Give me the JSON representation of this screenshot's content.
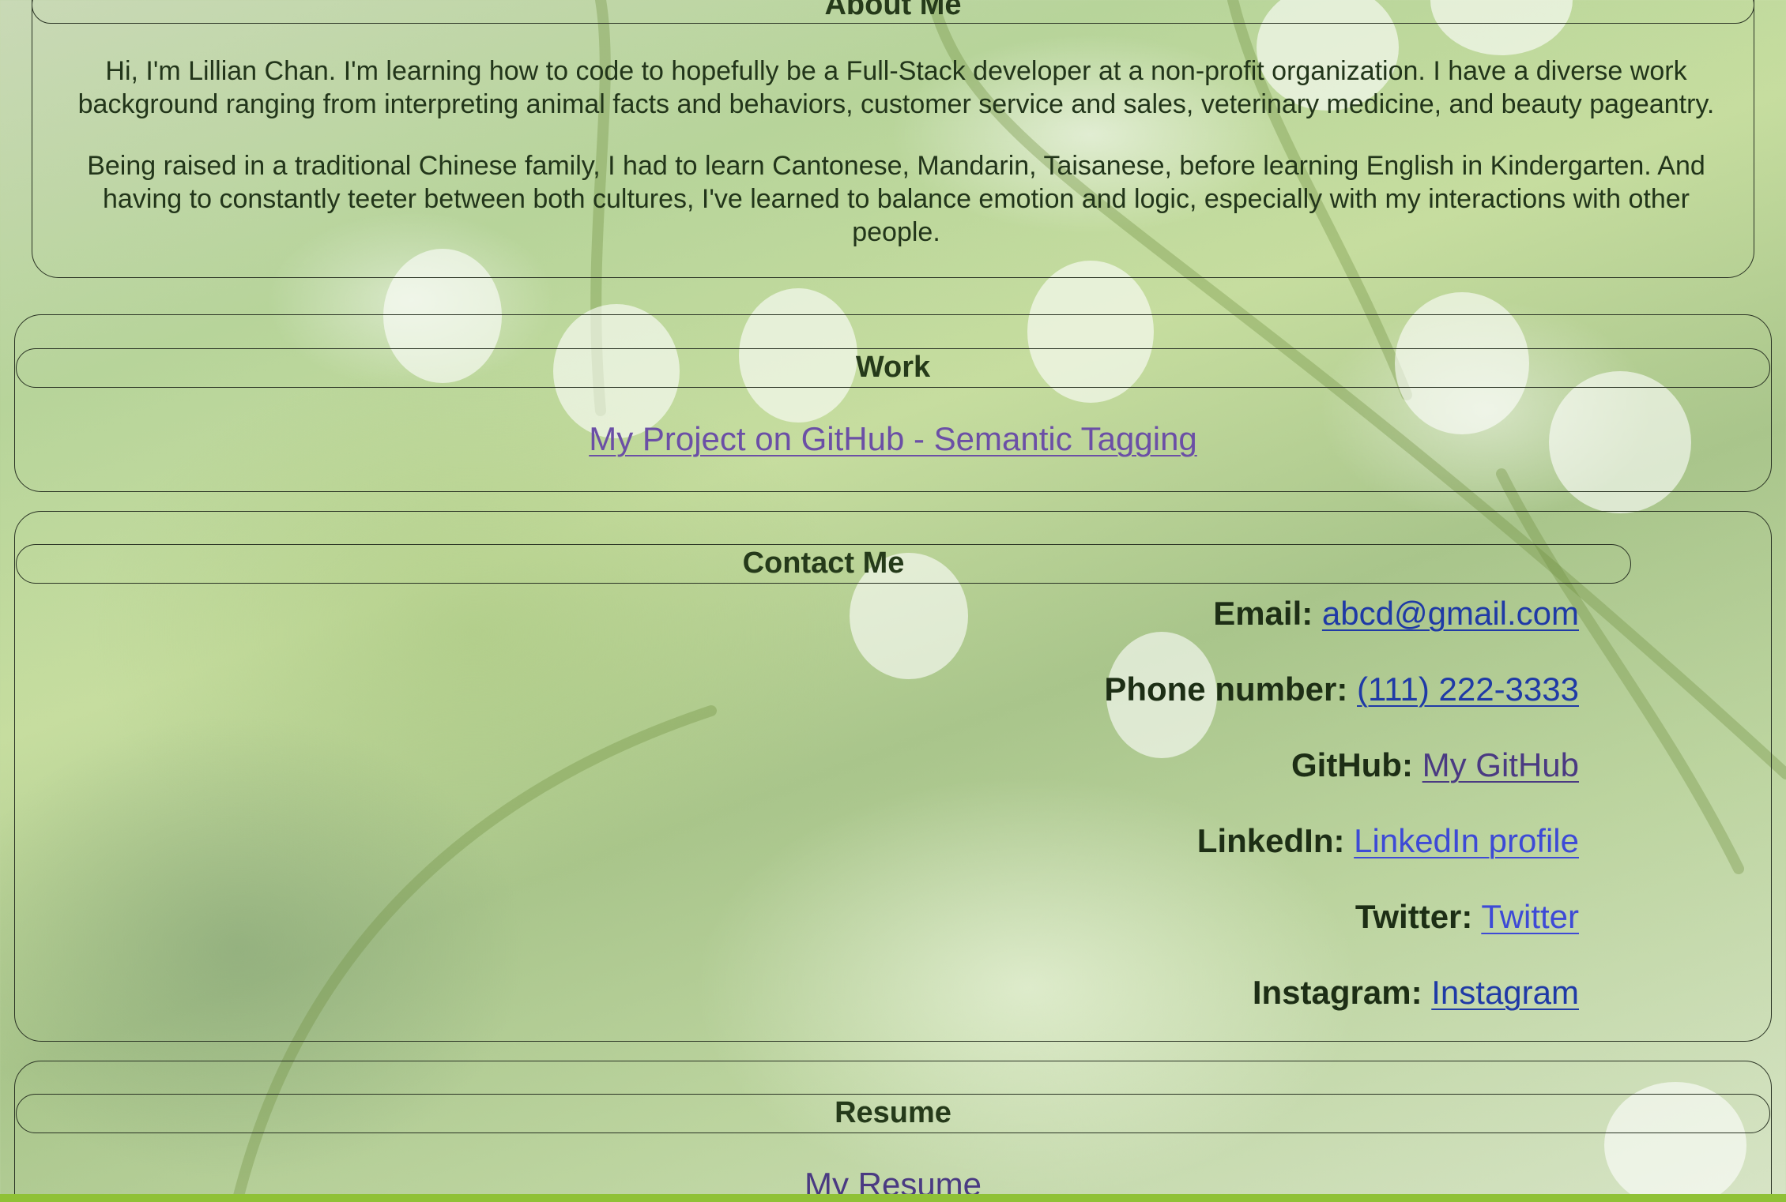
{
  "about": {
    "title": "About Me",
    "paragraph1_line1": "Hi, I'm Lillian Chan. I'm learning how to code to hopefully be a Full-Stack developer at a non-profit organization. I have a diverse work",
    "paragraph1_line2": "background ranging from interpreting animal facts and behaviors, customer service and sales, veterinary medicine, and beauty pageantry.",
    "paragraph2_line1": "Being raised in a traditional Chinese family, I had to learn Cantonese, Mandarin, Taisanese, before learning English in Kindergarten. And",
    "paragraph2_line2": "having to constantly teeter between both cultures, I've learned to balance emotion and logic, especially with my interactions with other",
    "paragraph2_line3": "people."
  },
  "work": {
    "title": "Work",
    "project_link": "My Project on GitHub - Semantic Tagging"
  },
  "contact": {
    "title": "Contact Me",
    "items": [
      {
        "label": "Email:",
        "value": "abcd@gmail.com"
      },
      {
        "label": "Phone number:",
        "value": "(111) 222-3333"
      },
      {
        "label": "GitHub:",
        "value": "My GitHub"
      },
      {
        "label": "LinkedIn:",
        "value": "LinkedIn profile"
      },
      {
        "label": "Twitter:",
        "value": "Twitter"
      },
      {
        "label": "Instagram:",
        "value": "Instagram"
      }
    ]
  },
  "resume": {
    "title": "Resume",
    "link": "My Resume"
  },
  "colors": {
    "link_visited": "#6b4fa6",
    "link_blue": "#1f3aa6",
    "accent_bar": "#8fc136"
  }
}
